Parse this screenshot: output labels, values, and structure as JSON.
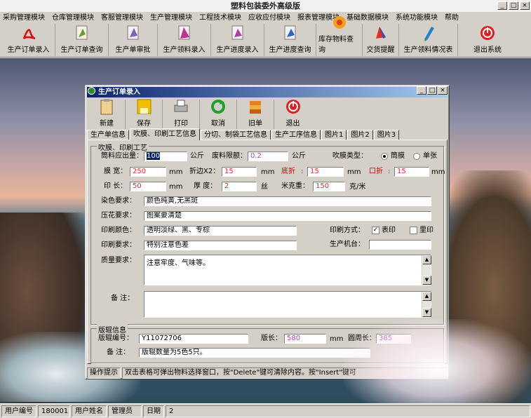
{
  "app": {
    "title": "塑料包装委外高级版"
  },
  "menu": [
    "采购管理模块",
    "仓库管理模块",
    "客服管理模块",
    "生产管理模块",
    "工程技术模块",
    "应收应付模块",
    "报表管理模块",
    "基础数据模块",
    "系统功能模块",
    "帮助"
  ],
  "toolbar": [
    {
      "label": "生产订单录入",
      "icon": "pdf-icon"
    },
    {
      "label": "生产订单查询",
      "icon": "order-query-icon"
    },
    {
      "label": "生产单审批",
      "icon": "approve-icon"
    },
    {
      "label": "生产领料录入",
      "icon": "material-icon"
    },
    {
      "label": "生产进度录入",
      "icon": "progress-entry-icon"
    },
    {
      "label": "生产进度查询",
      "icon": "progress-query-icon"
    },
    {
      "label": "库存物料查询",
      "icon": "flower-icon"
    },
    {
      "label": "交货提醒",
      "icon": "alert-icon"
    },
    {
      "label": "生产领料情况表",
      "icon": "pen-icon"
    },
    {
      "label": "退出系统",
      "icon": "power-icon"
    }
  ],
  "dialog": {
    "title": "生产订单录入",
    "toolbar": [
      "新建",
      "保存",
      "打印",
      "取消",
      "旧单",
      "退出"
    ],
    "tabs": [
      "生产单信息",
      "吹膜、印刷工艺信息",
      "分切、制袋工艺信息",
      "生产工序信息",
      "图片1",
      "图片2",
      "图片3"
    ],
    "blow_group": "吹膜、印刷工艺",
    "fields": {
      "gross_label": "筒料应出量：",
      "gross_value": "100",
      "gross_unit": "公斤",
      "waste_label": "废料限额：",
      "waste_value": "0.2",
      "waste_unit": "公斤",
      "film_type_label": "吹膜类型：",
      "film_opt1": "筒膜",
      "film_opt2": "单张",
      "width_label": "膜  宽：",
      "width_value": "250",
      "width_unit": "mm",
      "fold_label": "折边X2：",
      "fold_value": "15",
      "fold_unit": "mm",
      "bottom_label": "底折",
      "bottom_value": "15",
      "bottom_unit": "mm",
      "mouth_label": "口折",
      "mouth_value": "15",
      "mouth_unit": "mm",
      "print_len_label": "印  长：",
      "print_len_value": "50",
      "print_len_unit": "mm",
      "thick_label": "厚  度：",
      "thick_value": "2",
      "thick_unit": "丝",
      "gram_label": "米克重：",
      "gram_value": "150",
      "gram_unit": "克/米",
      "dye_label": "染色要求：",
      "dye_value": "颜色纯黄,无黑斑",
      "press_label": "压花要求：",
      "press_value": "图案要清楚",
      "color_label": "印刷颜色：",
      "color_value": "透明淡绿、黑、专棕",
      "print_method_label": "印刷方式：",
      "method_opt1": "表印",
      "method_opt2": "里印",
      "print_req_label": "印刷要求：",
      "print_req_value": "特别注意色差",
      "machine_label": "生产机台：",
      "machine_value": "",
      "quality_label": "质量要求：",
      "quality_value": "注意牢度、气味等。",
      "remark_label": "备  注：",
      "remark_value": ""
    },
    "plate_group": "版辊信息",
    "plate": {
      "no_label": "版辊编号：",
      "no_value": "Y11072706",
      "len_label": "版长：",
      "len_value": "580",
      "len_unit": "mm",
      "circ_label": "圆周长：",
      "circ_value": "385",
      "remark_label": "备  注：",
      "remark_value": "版辊数量为5色5只。"
    },
    "hint_label": "操作提示",
    "hint_text": "双击表格可弹出物料选择窗口，按\"Delete\"键可清除内容。按\"Insert\"键可"
  },
  "status": [
    {
      "label": "用户编号"
    },
    {
      "label": "180001"
    },
    {
      "label": "用户姓名"
    },
    {
      "label": "管理员"
    },
    {
      "label": "日期"
    },
    {
      "label": "2"
    }
  ]
}
